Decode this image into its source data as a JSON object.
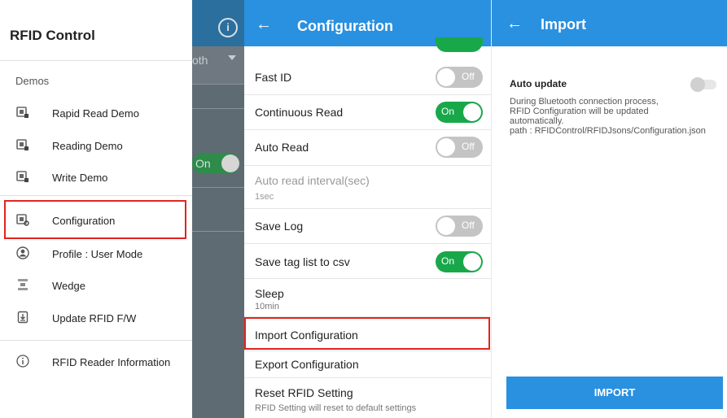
{
  "drawer": {
    "title": "RFID Control",
    "section_label": "Demos",
    "items": [
      {
        "label": "Rapid Read Demo",
        "icon": "rfid-reader-icon"
      },
      {
        "label": "Reading Demo",
        "icon": "rfid-reader-icon"
      },
      {
        "label": "Write Demo",
        "icon": "rfid-reader-icon"
      },
      {
        "label": "Configuration",
        "icon": "configuration-icon"
      },
      {
        "label": "Profile : User Mode",
        "icon": "profile-icon"
      },
      {
        "label": "Wedge",
        "icon": "wedge-icon"
      },
      {
        "label": "Update RFID F/W",
        "icon": "update-icon"
      },
      {
        "label": "RFID Reader Information",
        "icon": "info-icon"
      }
    ],
    "highlighted_item": "Configuration"
  },
  "background_screen": {
    "dropdown_text": "oth",
    "toggle_label": "On"
  },
  "configuration": {
    "title": "Configuration",
    "rows": [
      {
        "label": "Fast ID",
        "toggle": "Off"
      },
      {
        "label": "Continuous Read",
        "toggle": "On"
      },
      {
        "label": "Auto Read",
        "toggle": "Off"
      },
      {
        "label": "Auto read interval(sec)",
        "sub": "1sec"
      },
      {
        "label": "Save Log",
        "toggle": "Off"
      },
      {
        "label": "Save tag list to csv",
        "toggle": "On"
      },
      {
        "label": "Sleep",
        "sub": "10min"
      },
      {
        "label": "Import Configuration"
      },
      {
        "label": "Export Configuration"
      },
      {
        "label": "Reset RFID Setting",
        "sub": "RFID Setting will reset to default settings"
      }
    ],
    "highlighted_item": "Import Configuration"
  },
  "import": {
    "title": "Import",
    "auto_update_label": "Auto update",
    "description": "During Bluetooth connection process,\nRFID Configuration will be updated\nautomatically.\npath : RFIDControl/RFIDJsons/Configuration.json",
    "import_button": "IMPORT"
  },
  "colors": {
    "header_blue": "#2a90e0",
    "toggle_green": "#18a84a",
    "highlight_red": "#e3231e"
  }
}
